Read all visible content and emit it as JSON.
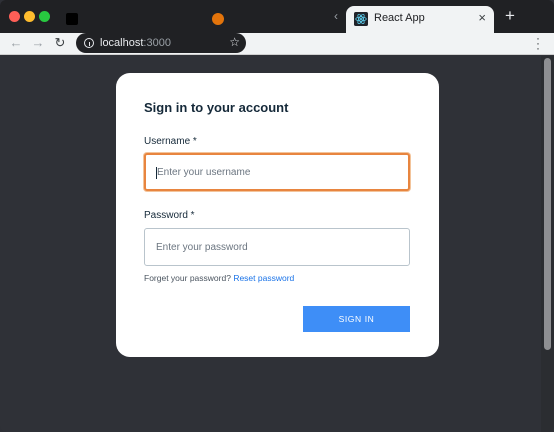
{
  "browser": {
    "active_tab_title": "React App",
    "url_host": "localhost",
    "url_port": ":3000",
    "new_tab_symbol": "+",
    "close_symbol": "×"
  },
  "signin": {
    "title": "Sign in to your account",
    "username_label": "Username *",
    "username_placeholder": "Enter your username",
    "password_label": "Password *",
    "password_placeholder": "Enter your password",
    "forgot_text": "Forget your password?",
    "reset_link": "Reset password",
    "submit_label": "SIGN IN"
  },
  "colors": {
    "page_bg": "#2f3137",
    "focus_border": "#e8853f",
    "button_bg": "#3e8ef7",
    "link": "#1a73e8"
  }
}
